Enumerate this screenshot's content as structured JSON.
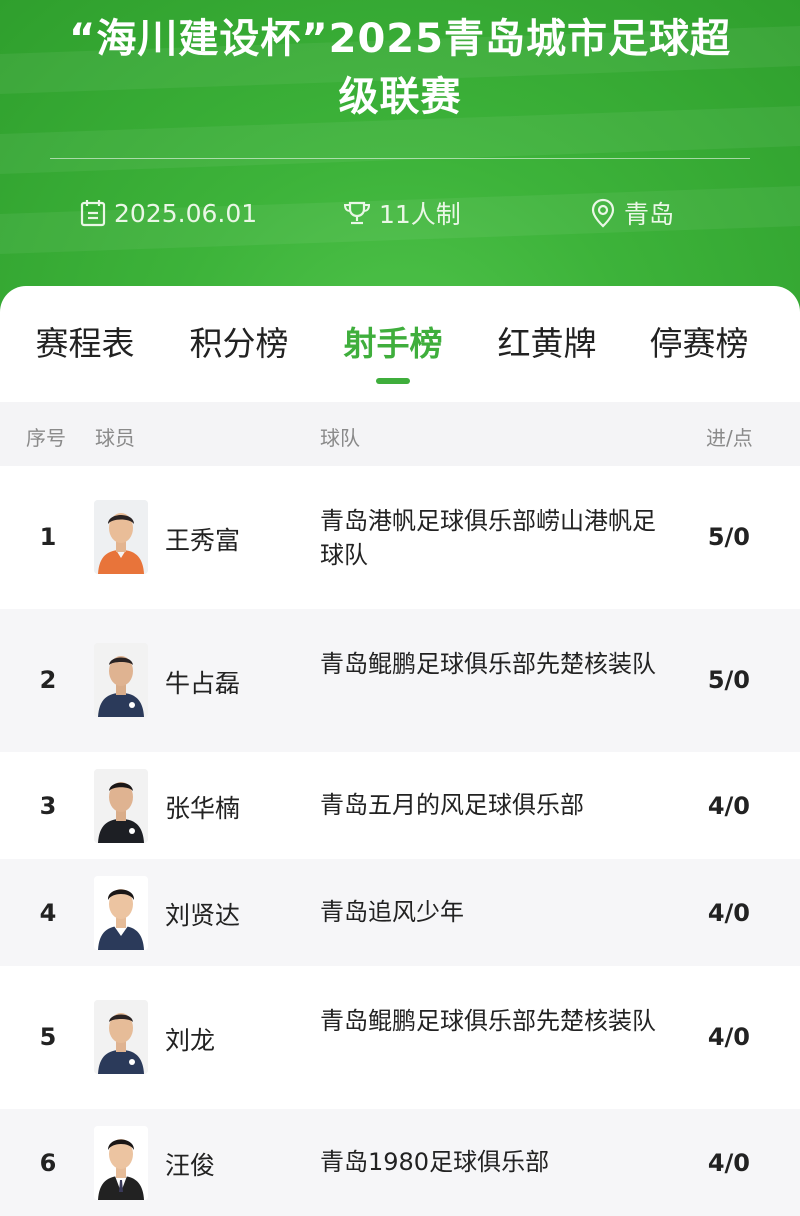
{
  "header": {
    "title_line1": "“海川建设杯”2025青岛城市足球超",
    "title_line2": "级联赛",
    "date": "2025.06.01",
    "format": "11人制",
    "location": "青岛"
  },
  "tabs": [
    {
      "label": "赛程表",
      "active": false
    },
    {
      "label": "积分榜",
      "active": false
    },
    {
      "label": "射手榜",
      "active": true
    },
    {
      "label": "红黄牌",
      "active": false
    },
    {
      "label": "停赛榜",
      "active": false
    }
  ],
  "table": {
    "columns": {
      "rank": "序号",
      "player": "球员",
      "team": "球队",
      "goals": "进/点"
    },
    "rows": [
      {
        "rank": "1",
        "name": "王秀富",
        "team": "青岛港帆足球俱乐部崂山港帆足球队",
        "goals": "5/0",
        "jersey": "orange"
      },
      {
        "rank": "2",
        "name": "牛占磊",
        "team": "青岛鲲鹏足球俱乐部先楚核装队",
        "goals": "5/0",
        "jersey": "navy"
      },
      {
        "rank": "3",
        "name": "张华楠",
        "team": "青岛五月的风足球俱乐部",
        "goals": "4/0",
        "jersey": "black"
      },
      {
        "rank": "4",
        "name": "刘贤达",
        "team": "青岛追风少年",
        "goals": "4/0",
        "jersey": "navy-white"
      },
      {
        "rank": "5",
        "name": "刘龙",
        "team": "青岛鲲鹏足球俱乐部先楚核装队",
        "goals": "4/0",
        "jersey": "navy"
      },
      {
        "rank": "6",
        "name": "汪俊",
        "team": "青岛1980足球俱乐部",
        "goals": "4/0",
        "jersey": "suit"
      }
    ]
  },
  "colors": {
    "header_green": "#3db33a",
    "active_tab": "#3fae3c",
    "jersey_orange": "#e8743a",
    "jersey_navy": "#2b3a5a",
    "jersey_black": "#1d1f24"
  },
  "icons": {
    "date": "calendar-icon",
    "format": "trophy-icon",
    "location": "location-pin-icon"
  }
}
